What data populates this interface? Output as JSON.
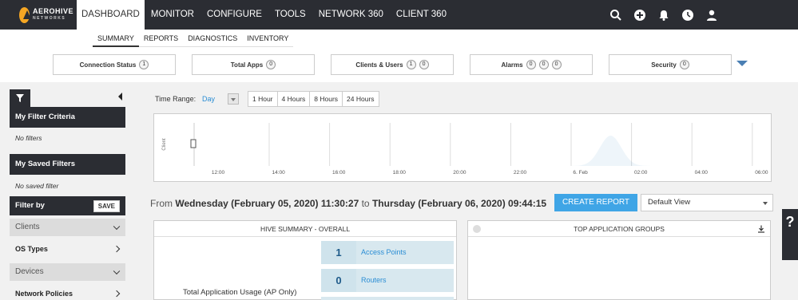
{
  "brand": {
    "name": "AEROHIVE",
    "sub": "NETWORKS"
  },
  "nav": {
    "items": [
      "DASHBOARD",
      "MONITOR",
      "CONFIGURE",
      "TOOLS",
      "NETWORK 360",
      "CLIENT 360"
    ],
    "icons": [
      "search-icon",
      "add-icon",
      "bell-icon",
      "clock-icon",
      "user-icon"
    ]
  },
  "subnav": [
    "SUMMARY",
    "REPORTS",
    "DIAGNOSTICS",
    "INVENTORY"
  ],
  "status": [
    {
      "label": "Connection Status",
      "counts": [
        "1"
      ]
    },
    {
      "label": "Total Apps",
      "counts": [
        "0"
      ]
    },
    {
      "label": "Clients & Users",
      "counts": [
        "1",
        "0"
      ]
    },
    {
      "label": "Alarms",
      "counts": [
        "0",
        "0",
        "0"
      ]
    },
    {
      "label": "Security",
      "counts": [
        "0"
      ]
    }
  ],
  "sidebar": {
    "filter_criteria": "My Filter Criteria",
    "no_filters": "No filters",
    "saved_filters": "My Saved Filters",
    "no_saved": "No saved filter",
    "filter_by": "Filter by",
    "save": "SAVE",
    "groups": [
      "Clients",
      "OS Types",
      "Devices",
      "Network Policies"
    ]
  },
  "time_range": {
    "label": "Time Range:",
    "value": "Day",
    "buttons": [
      "1 Hour",
      "4 Hours",
      "8 Hours",
      "24 Hours"
    ]
  },
  "chart_data": {
    "type": "area",
    "ylabel": "Client",
    "x_ticks": [
      "12:00",
      "14:00",
      "16:00",
      "18:00",
      "20:00",
      "22:00",
      "6. Feb",
      "02:00",
      "04:00",
      "06:00"
    ],
    "peak": {
      "x": "01:00",
      "y": 1
    },
    "color": "#2a7fc0"
  },
  "date_range": {
    "from_word": "From",
    "from": "Wednesday (February 05, 2020) 11:30:27",
    "to_word": "to",
    "to": "Thursday (February 06, 2020) 09:44:15"
  },
  "create_report": "CREATE REPORT",
  "view": "Default View",
  "hive_summary": {
    "title": "HIVE SUMMARY - OVERALL",
    "rows": [
      {
        "value": "1",
        "label": "Access Points"
      },
      {
        "value": "0",
        "label": "Routers"
      }
    ],
    "usage_label": "Total Application Usage (AP Only)"
  },
  "top_apps": {
    "title": "TOP APPLICATION GROUPS"
  },
  "help": "?"
}
